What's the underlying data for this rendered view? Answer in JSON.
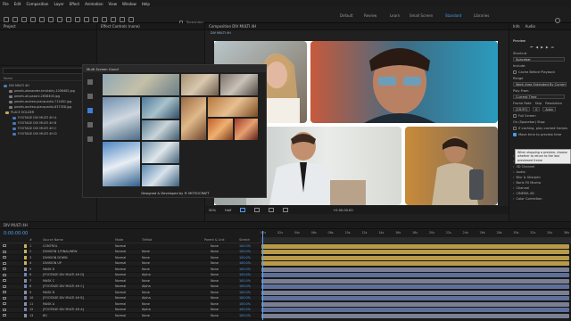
{
  "menu": [
    "File",
    "Edit",
    "Composition",
    "Layer",
    "Effect",
    "Animation",
    "View",
    "Window",
    "Help"
  ],
  "workspaces": [
    {
      "label": "Default",
      "active": false
    },
    {
      "label": "Review",
      "active": false
    },
    {
      "label": "Learn",
      "active": false
    },
    {
      "label": "Small Screen",
      "active": false
    },
    {
      "label": "Standard",
      "active": true
    },
    {
      "label": "Libraries",
      "active": false
    }
  ],
  "toolbar": {
    "snapping_label": "Snapping"
  },
  "project": {
    "tab_label": "Project",
    "search_placeholder": "",
    "name_header": "Name",
    "items": [
      {
        "name": "DIV MULTI 4H",
        "type": "comp"
      },
      {
        "name": "pexels-alexander-krivitskiy-1036482.jpg",
        "type": "image"
      },
      {
        "name": "pexels-ali-pazani-2658400.jpg",
        "type": "image"
      },
      {
        "name": "pexels-andrea-piacquadio-712461.jpg",
        "type": "image"
      },
      {
        "name": "pexels-andrea-piacquadio-837358.jpg",
        "type": "image"
      },
      {
        "name": "PLACE HOLDER",
        "type": "folder"
      },
      {
        "name": "FOOTAGE DIV MULTI 4H A",
        "type": "comp"
      },
      {
        "name": "FOOTAGE DIV MULTI 4H B",
        "type": "comp"
      },
      {
        "name": "FOOTAGE DIV MULTI 4H C",
        "type": "comp"
      },
      {
        "name": "FOOTAGE DIV MULTI 4H D",
        "type": "comp"
      }
    ]
  },
  "effect_controls": {
    "tab_label": "Effect Controls (none)"
  },
  "composition": {
    "tab_label": "Composition DIV MULTI 4H",
    "crumb": "DIV MULTI 4H",
    "footer": {
      "zoom": "50%",
      "resolution": "Half",
      "timecode": "+0.00.00.00"
    }
  },
  "plugin_window": {
    "title": "Multi Screen Gusuf",
    "credit": "Designed & Developed by ® MOTIOCRAFT"
  },
  "preview": {
    "tab_labels": [
      "Info",
      "Audio"
    ],
    "title": "Preview",
    "shortcut_label": "Shortcut",
    "shortcut_value": "Spacebar",
    "include_label": "Include:",
    "cache_label": "Cache Before Playback",
    "range_label": "Range",
    "range_value": "Work Area Extended By Current...",
    "play_from_label": "Play From",
    "play_from_value": "Current Time",
    "frame_rate_label": "Frame Rate",
    "skip_label": "Skip",
    "resolution_label": "Resolution",
    "frame_rate_value": "(29.97)",
    "skip_value": "0",
    "resolution_value": "Auto",
    "full_screen_label": "Full Screen",
    "on_stop_label": "On (Spacebar) Stop:",
    "if_caching_label": "If caching, play cached frames",
    "move_time_label": "Move time to preview time",
    "tooltip": "When stopping a preview, choose whether to return to the last previewed frame",
    "panel_list": [
      "Effects & Presets",
      "Animation Presets",
      "3D Channel",
      "Audio",
      "Blur & Sharpen",
      "Boris FX Mocha",
      "Channel",
      "CINEMA 4D",
      "Color Correction"
    ]
  },
  "timeline": {
    "tab_label": "DIV MULTI 4H",
    "timecode": "0:00:00:00",
    "headers": {
      "num": "#",
      "source": "Source Name",
      "mode": "Mode",
      "trkmat": "TrkMat",
      "parent": "Parent & Link",
      "stretch": "Stretch"
    },
    "ruler": [
      "00s",
      "02s",
      "04s",
      "06s",
      "08s",
      "10s",
      "12s",
      "14s",
      "16s",
      "18s",
      "20s",
      "22s",
      "24s",
      "26s",
      "28s",
      "30s",
      "32s",
      "34s",
      "36s"
    ],
    "layers": [
      {
        "num": "1",
        "name": "CONTROL",
        "mode": "Normal",
        "trkmat": "",
        "parent": "None",
        "stretch": "100.0%",
        "label_color": "#c7b35a",
        "bar_color": "#b89a4a"
      },
      {
        "num": "2",
        "name": "DIVISION 1/FINAL/NEW",
        "mode": "Normal",
        "trkmat": "None",
        "parent": "None",
        "stretch": "100.0%",
        "label_color": "#c7b35a",
        "bar_color": "#b89a4a"
      },
      {
        "num": "3",
        "name": "DIVISION DOWN",
        "mode": "Normal",
        "trkmat": "None",
        "parent": "None",
        "stretch": "100.0%",
        "label_color": "#c7b35a",
        "bar_color": "#b89a4a"
      },
      {
        "num": "4",
        "name": "DIVISION UP",
        "mode": "Normal",
        "trkmat": "None",
        "parent": "None",
        "stretch": "100.0%",
        "label_color": "#c7b35a",
        "bar_color": "#b89a4a"
      },
      {
        "num": "5",
        "name": "MASK D",
        "mode": "Normal",
        "trkmat": "None",
        "parent": "None",
        "stretch": "100.0%",
        "label_color": "#8b8fa0",
        "bar_color": "#7a7f93"
      },
      {
        "num": "6",
        "name": "[FOOTAGE DIV MULTI 4H D]",
        "mode": "Normal",
        "trkmat": "Alpha",
        "parent": "None",
        "stretch": "100.0%",
        "label_color": "#6e84b8",
        "bar_color": "#5e6f9a"
      },
      {
        "num": "7",
        "name": "MASK C",
        "mode": "Normal",
        "trkmat": "None",
        "parent": "None",
        "stretch": "100.0%",
        "label_color": "#8b8fa0",
        "bar_color": "#7a7f93"
      },
      {
        "num": "8",
        "name": "[FOOTAGE DIV MULTI 4H C]",
        "mode": "Normal",
        "trkmat": "Alpha",
        "parent": "None",
        "stretch": "100.0%",
        "label_color": "#6e84b8",
        "bar_color": "#5e6f9a"
      },
      {
        "num": "9",
        "name": "MASK B",
        "mode": "Normal",
        "trkmat": "None",
        "parent": "None",
        "stretch": "100.0%",
        "label_color": "#8b8fa0",
        "bar_color": "#7a7f93"
      },
      {
        "num": "10",
        "name": "[FOOTAGE DIV MULTI 4H B]",
        "mode": "Normal",
        "trkmat": "Alpha",
        "parent": "None",
        "stretch": "100.0%",
        "label_color": "#6e84b8",
        "bar_color": "#5e6f9a"
      },
      {
        "num": "11",
        "name": "MASK A",
        "mode": "Normal",
        "trkmat": "None",
        "parent": "None",
        "stretch": "100.0%",
        "label_color": "#8b8fa0",
        "bar_color": "#7a7f93"
      },
      {
        "num": "12",
        "name": "[FOOTAGE DIV MULTI 4H A]",
        "mode": "Normal",
        "trkmat": "Alpha",
        "parent": "None",
        "stretch": "100.0%",
        "label_color": "#6e84b8",
        "bar_color": "#5e6f9a"
      },
      {
        "num": "13",
        "name": "BG",
        "mode": "Normal",
        "trkmat": "None",
        "parent": "None",
        "stretch": "100.0%",
        "label_color": "#8b8fa0",
        "bar_color": "#7a7f93"
      }
    ]
  },
  "colors": {
    "accent": "#4a9cf0",
    "playhead": "#5aa0f0",
    "panel_bg": "#1e1e1e",
    "app_bg": "#121212"
  }
}
